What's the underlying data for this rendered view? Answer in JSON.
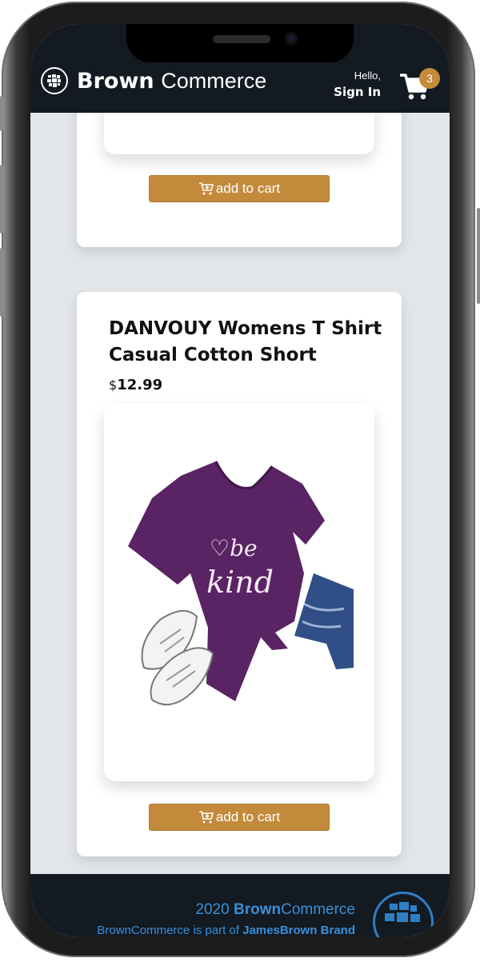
{
  "header": {
    "brand_bold": "Brown",
    "brand_light": "Commerce",
    "hello": "Hello,",
    "sign_in": "Sign In",
    "cart_count": "3",
    "logo_icon": "globe-logo-icon",
    "cart_icon": "shopping-cart-icon"
  },
  "products": [
    {
      "title": "",
      "price_currency": "",
      "price_amount": "",
      "add_label": "add to cart",
      "image": "red-product-image"
    },
    {
      "title": "DANVOUY Womens T Shirt Casual Cotton Short",
      "price_currency": "$",
      "price_amount": "12.99",
      "add_label": "add to cart",
      "image": "purple-be-kind-tshirt-image"
    }
  ],
  "footer": {
    "year": "2020",
    "brand_bold": "Brown",
    "brand_light": "Commerce",
    "tagline_prefix": "BrownCommerce is part of ",
    "tagline_brand": "JamesBrown Brand"
  },
  "colors": {
    "header_bg": "#131a22",
    "accent": "#c48a3c",
    "footer_text": "#3a8fd6",
    "page_bg": "#e3e6e9"
  }
}
